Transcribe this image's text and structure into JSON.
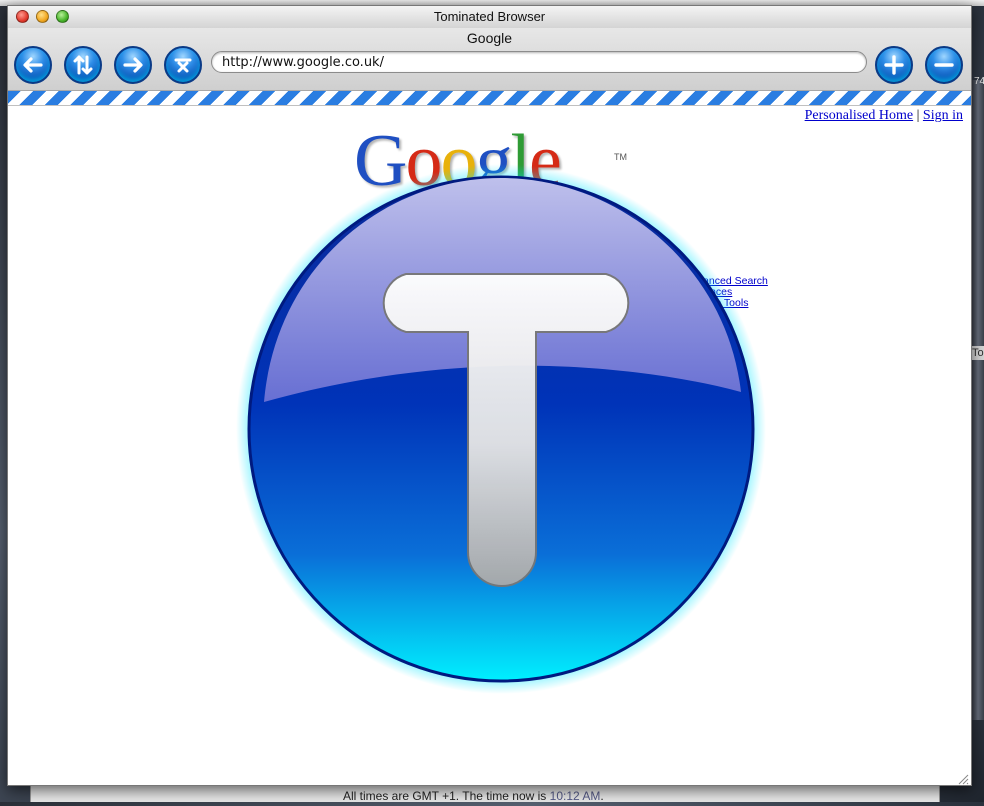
{
  "window": {
    "title": "Tominated Browser",
    "page_title": "Google",
    "url": "http://www.google.co.uk/"
  },
  "toolbar": {
    "buttons": [
      {
        "name": "back",
        "icon": "arrow-left-icon"
      },
      {
        "name": "reload",
        "icon": "reload-arrows-icon"
      },
      {
        "name": "forward",
        "icon": "arrow-right-icon"
      },
      {
        "name": "stop",
        "icon": "close-x-icon"
      },
      {
        "name": "zoom-in",
        "icon": "plus-icon"
      },
      {
        "name": "zoom-out",
        "icon": "minus-icon"
      }
    ]
  },
  "google": {
    "logo_letters": [
      "G",
      "o",
      "o",
      "g",
      "l",
      "e"
    ],
    "trademark": "TM",
    "top_links": {
      "personalised_home": "Personalised Home",
      "separator": "|",
      "sign_in": "Sign in"
    },
    "side_links": [
      "dvanced Search",
      "ferences",
      "guage Tools"
    ]
  },
  "overlay": {
    "logo_letter": "T",
    "icon": "tominated-logo-icon"
  },
  "background": {
    "bottom_text": "All times are GMT +1. The time now is",
    "bottom_time": "10:12 AM",
    "bottom_period": ".",
    "edge_tab": "To",
    "edge_number": "74"
  },
  "colors": {
    "accent_blue": "#0c53b8",
    "glow_cyan": "#00e5ff",
    "stripe_blue": "#2a7de1",
    "link_blue": "#0000cc"
  }
}
